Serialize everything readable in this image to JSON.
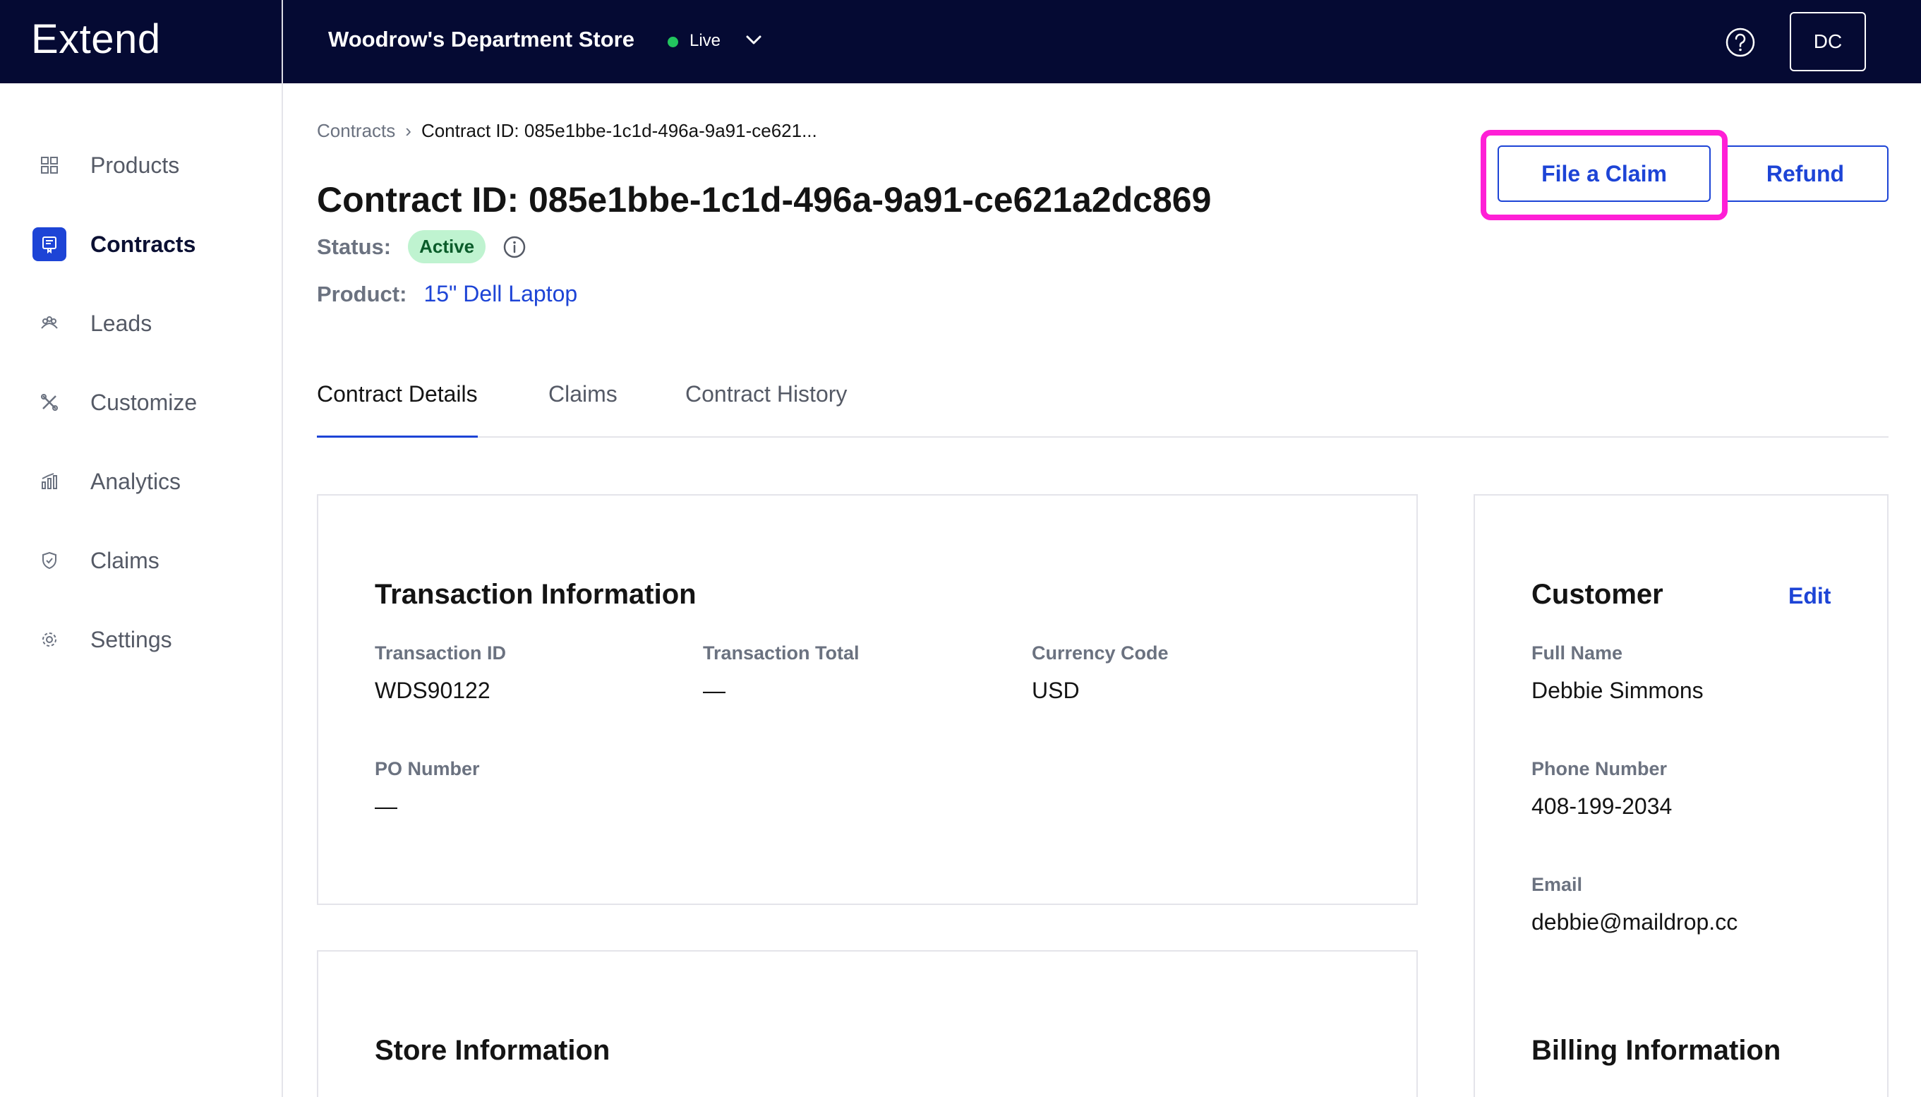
{
  "app": {
    "brand": "Extend"
  },
  "header": {
    "store_name": "Woodrow's Department Store",
    "live_label": "Live",
    "avatar_initials": "DC"
  },
  "sidebar": {
    "items": [
      {
        "label": "Products",
        "icon": "grid-icon"
      },
      {
        "label": "Contracts",
        "icon": "contract-icon",
        "active": true
      },
      {
        "label": "Leads",
        "icon": "leads-icon"
      },
      {
        "label": "Customize",
        "icon": "tools-icon"
      },
      {
        "label": "Analytics",
        "icon": "chart-icon"
      },
      {
        "label": "Claims",
        "icon": "shield-icon"
      },
      {
        "label": "Settings",
        "icon": "gear-icon"
      }
    ]
  },
  "breadcrumb": {
    "parent": "Contracts",
    "separator": "›",
    "current": "Contract ID: 085e1bbe-1c1d-496a-9a91-ce621..."
  },
  "contract": {
    "title": "Contract ID: 085e1bbe-1c1d-496a-9a91-ce621a2dc869",
    "status_label": "Status:",
    "status_value": "Active",
    "product_label": "Product:",
    "product_value": "15\" Dell Laptop"
  },
  "actions": {
    "file_claim": "File a Claim",
    "refund": "Refund"
  },
  "tabs": [
    {
      "label": "Contract Details",
      "active": true
    },
    {
      "label": "Claims"
    },
    {
      "label": "Contract History"
    }
  ],
  "transaction": {
    "title": "Transaction Information",
    "fields": [
      {
        "label": "Transaction ID",
        "value": "WDS90122"
      },
      {
        "label": "Transaction Total",
        "value": "—"
      },
      {
        "label": "Currency Code",
        "value": "USD"
      },
      {
        "label": "PO Number",
        "value": "—"
      }
    ]
  },
  "store": {
    "title": "Store Information"
  },
  "customer": {
    "title": "Customer",
    "edit_label": "Edit",
    "fields": [
      {
        "label": "Full Name",
        "value": "Debbie Simmons"
      },
      {
        "label": "Phone Number",
        "value": "408-199-2034"
      },
      {
        "label": "Email",
        "value": "debbie@maildrop.cc"
      }
    ],
    "billing_title": "Billing Information"
  },
  "colors": {
    "header_bg": "#050a33",
    "accent": "#1d44d6",
    "status_bg": "#bff3d0",
    "highlight": "#ff1fd6"
  }
}
